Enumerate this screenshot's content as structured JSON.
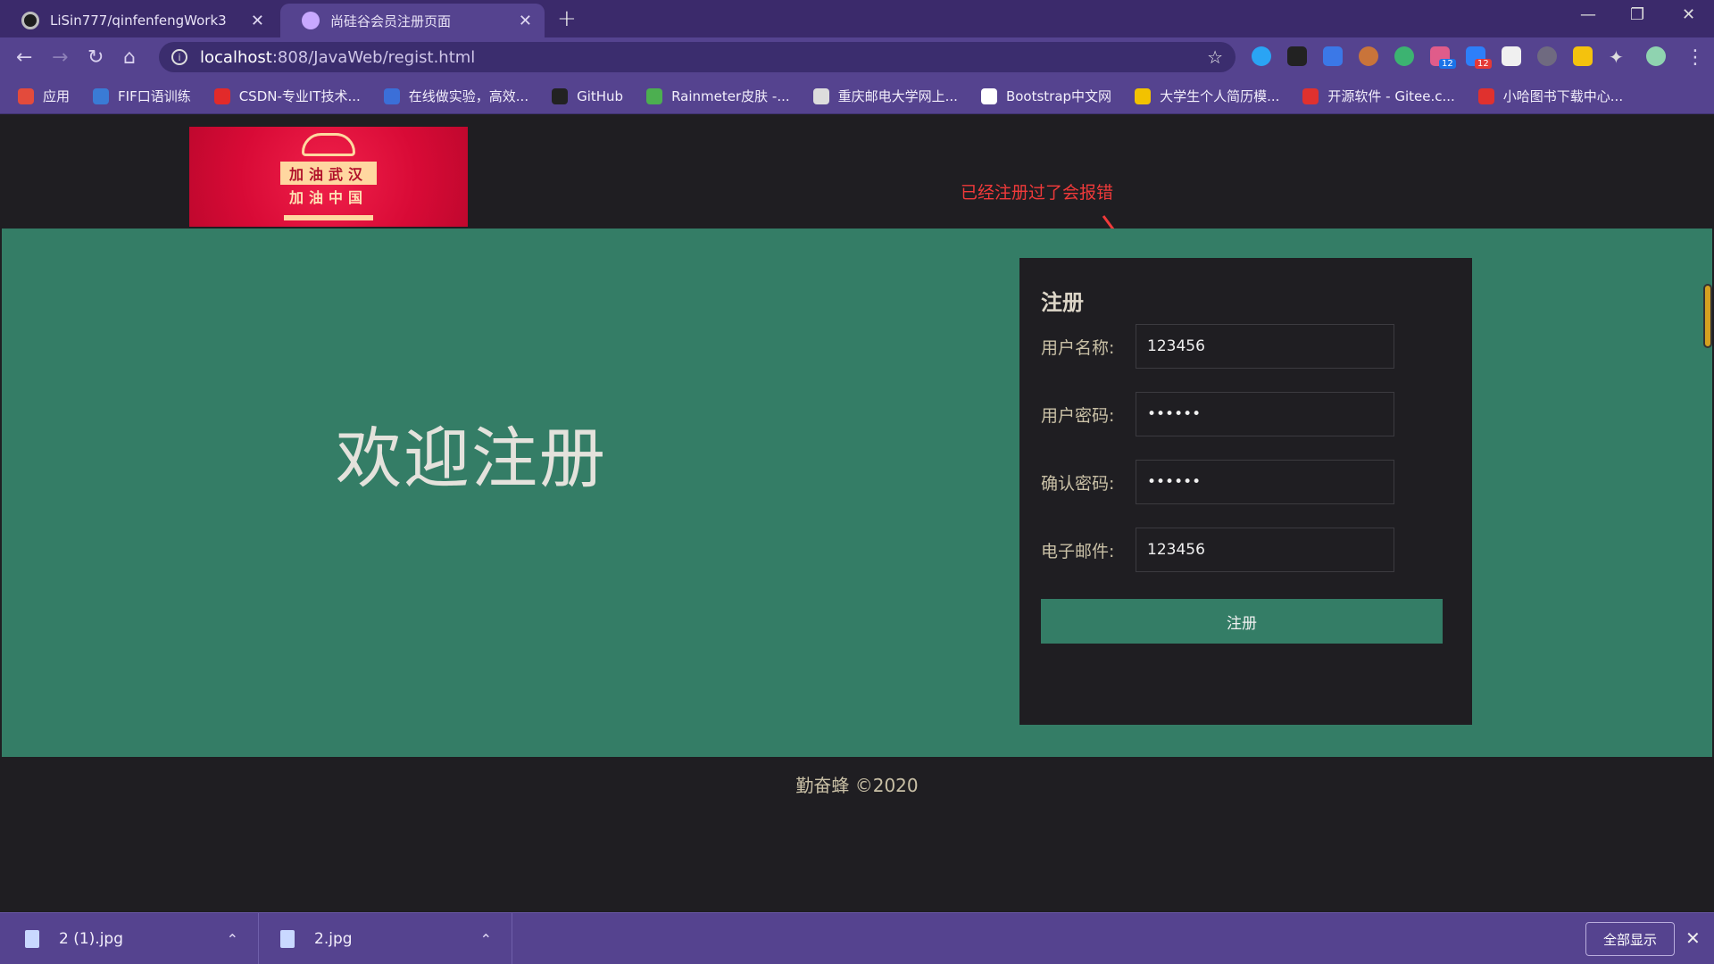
{
  "browser": {
    "tabs": [
      {
        "label": "LiSin777/qinfenfengWork3",
        "active": false
      },
      {
        "label": "尚硅谷会员注册页面",
        "active": true
      }
    ],
    "new_tab_glyph": "+",
    "close_glyph": "✕",
    "url_host": "localhost",
    "url_rest": ":808/JavaWeb/regist.html",
    "bookmarks": [
      {
        "label": "应用",
        "color": "#e34b3c"
      },
      {
        "label": "FIF口语训练",
        "color": "#3a7bd5"
      },
      {
        "label": "CSDN-专业IT技术...",
        "color": "#e22a2a"
      },
      {
        "label": "在线做实验，高效...",
        "color": "#3b6fd8"
      },
      {
        "label": "GitHub",
        "color": "#222222"
      },
      {
        "label": "Rainmeter皮肤 -...",
        "color": "#4caf50"
      },
      {
        "label": "重庆邮电大学网上...",
        "color": "#dddddd"
      },
      {
        "label": "Bootstrap中文网",
        "color": "#ffffff"
      },
      {
        "label": "大学生个人简历模...",
        "color": "#f2c200"
      },
      {
        "label": "开源软件 - Gitee.c...",
        "color": "#e0312e"
      },
      {
        "label": "小哈图书下载中心...",
        "color": "#e0312e"
      }
    ],
    "extension_badges": [
      "12",
      "12"
    ]
  },
  "page": {
    "logo": {
      "line1": "加油武汉",
      "line2": "加油中国"
    },
    "annotation": "已经注册过了会报错",
    "welcome": "欢迎注册",
    "form": {
      "title": "注册",
      "fields": [
        {
          "label": "用户名称:",
          "value": "123456",
          "type": "text"
        },
        {
          "label": "用户密码:",
          "value": "123456",
          "type": "password"
        },
        {
          "label": "确认密码:",
          "value": "123456",
          "type": "password"
        },
        {
          "label": "电子邮件:",
          "value": "123456",
          "type": "text"
        }
      ],
      "submit": "注册"
    },
    "footer": "勤奋蜂 ©2020",
    "colors": {
      "accent": "#347d66",
      "annotation": "#f03a3a",
      "chrome": "#55438f"
    }
  },
  "downloads": {
    "items": [
      {
        "name": "2 (1).jpg"
      },
      {
        "name": "2.jpg"
      }
    ],
    "show_all": "全部显示"
  }
}
